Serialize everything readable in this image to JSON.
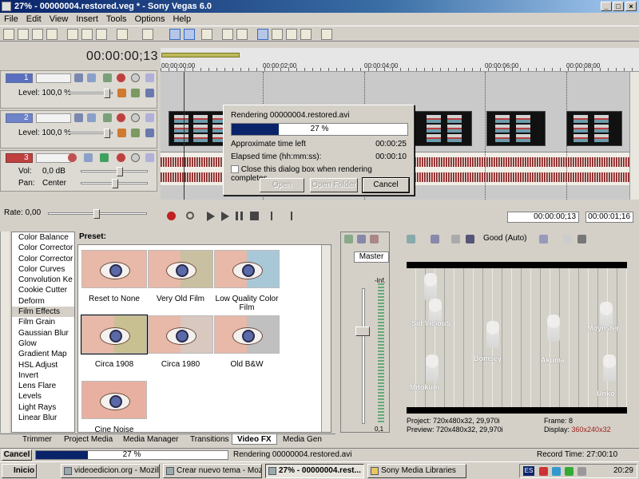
{
  "window": {
    "title": "27% - 00000004.restored.veg * - Sony Vegas 6.0"
  },
  "menu": [
    "File",
    "Edit",
    "View",
    "Insert",
    "Tools",
    "Options",
    "Help"
  ],
  "timecode": "00:00:00;13",
  "ruler": {
    "labels": [
      "00:00:00;00",
      "00:00:02;00",
      "00:00:04;00",
      "00:00:06;00",
      "00:00:08;00"
    ]
  },
  "tracks": [
    {
      "number": "1",
      "type": "video",
      "param_label": "Level:",
      "param_value": "100,0 %"
    },
    {
      "number": "2",
      "type": "video",
      "param_label": "Level:",
      "param_value": "100,0 %"
    },
    {
      "number": "3",
      "type": "audio",
      "vol_label": "Vol:",
      "vol_value": "0,0 dB",
      "pan_label": "Pan:",
      "pan_value": "Center"
    }
  ],
  "rate": "Rate: 0,00",
  "render_dialog": {
    "title": "Rendering 00000004.restored.avi",
    "progress_percent": 27,
    "progress_text": "27 %",
    "approx_label": "Approximate time left",
    "approx_value": "00:00:25",
    "elapsed_label": "Elapsed time (hh:mm:ss):",
    "elapsed_value": "00:00:10",
    "checkbox_label": "Close this dialog box when rendering completes",
    "checkbox_checked": false,
    "btn_open": "Open",
    "btn_open_folder": "Open Folder",
    "btn_cancel": "Cancel"
  },
  "transport": {
    "cursor_time": "00:00:00;13",
    "selection_length": "00:00:01;16"
  },
  "fx_list": [
    "Color Balance",
    "Color Corrector",
    "Color Corrector",
    "Color Curves",
    "Convolution Ke",
    "Cookie Cutter",
    "Deform",
    "Film Effects",
    "Film Grain",
    "Gaussian Blur",
    "Glow",
    "Gradient Map",
    "HSL Adjust",
    "Invert",
    "Lens Flare",
    "Levels",
    "Light Rays",
    "Linear Blur"
  ],
  "fx_selected": "Film Effects",
  "preset_title": "Preset:",
  "presets": [
    "Reset to None",
    "Very Old Film",
    "Low Quality Color Film",
    "Circa 1908",
    "Circa 1980",
    "Old B&W",
    "Cine Noise"
  ],
  "tabs": [
    "Trimmer",
    "Project Media",
    "Media Manager",
    "Transitions",
    "Video FX",
    "Media Gen"
  ],
  "active_tab": "Video FX",
  "mixer": {
    "master_label": "Master",
    "level_top": "-Inf.",
    "level_bottom": "0,1"
  },
  "preview": {
    "quality": "Good (Auto)",
    "video_labels": [
      "Sid ViciouS",
      "Moynster",
      "Domsey",
      "Akuma",
      "Mitokum",
      "Unko"
    ],
    "project_label": "Project:",
    "project_value": "720x480x32, 29,970i",
    "preview_label": "Preview:",
    "preview_value": "720x480x32, 29,970i",
    "frame_label": "Frame:",
    "frame_value": "8",
    "display_label": "Display:",
    "display_value": "360x240x32"
  },
  "status": {
    "cancel": "Cancel",
    "progress_percent": 27,
    "progress_text": "27 %",
    "message": "Rendering 00000004.restored.avi",
    "record_time": "Record Time: 27:00:10"
  },
  "taskbar": {
    "start": "Inicio",
    "tasks": [
      "videoedicion.org - Mozilla",
      "Crear nuevo tema - Mozilla",
      "27% - 00000004.rest...",
      "Sony Media Libraries"
    ],
    "active_task_index": 2,
    "lang": "ES",
    "clock": "20:29"
  },
  "colors": {
    "progress": "#0a246a",
    "display_value": "#a0201c",
    "title_start": "#0a246a"
  }
}
